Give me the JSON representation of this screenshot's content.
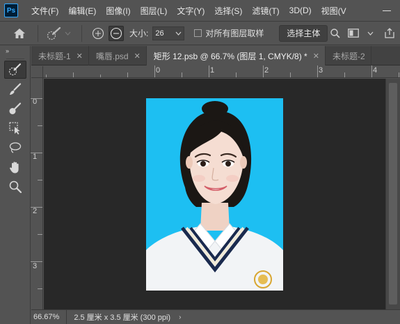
{
  "app": {
    "logo": "Ps",
    "menus": [
      "文件(F)",
      "编辑(E)",
      "图像(I)",
      "图层(L)",
      "文字(Y)",
      "选择(S)",
      "滤镜(T)",
      "3D(D)",
      "视图(V"
    ]
  },
  "options": {
    "size_label": "大小:",
    "size_value": "26",
    "sample_all_label": "对所有图层取样",
    "sample_all_checked": false,
    "subject_button": "选择主体"
  },
  "toolbar": {
    "collapse": "»",
    "tools": [
      "quick-selection-icon",
      "brush-icon",
      "mixer-brush-icon",
      "object-selection-icon",
      "lasso-icon",
      "hand-icon",
      "zoom-icon"
    ],
    "active_tool": "quick-selection-icon"
  },
  "tabs": [
    {
      "label": "未标题-1",
      "active": false
    },
    {
      "label": "嘴唇.psd",
      "active": false
    },
    {
      "label": "矩形 12.psb @ 66.7% (图层 1, CMYK/8) *",
      "active": true
    },
    {
      "label": "未标题-2",
      "active": false
    }
  ],
  "ruler": {
    "top_numbers": [
      "0",
      "1",
      "2",
      "3",
      "4"
    ],
    "left_numbers": [
      "0",
      "1",
      "2",
      "3"
    ]
  },
  "status": {
    "zoom": "66.67%",
    "doc_info": "2.5 厘米 x 3.5 厘米 (300 ppi)",
    "arrow": "›"
  },
  "colors": {
    "photo_background": "#1dbff2",
    "ui_panel": "#535353",
    "canvas": "#282828"
  }
}
